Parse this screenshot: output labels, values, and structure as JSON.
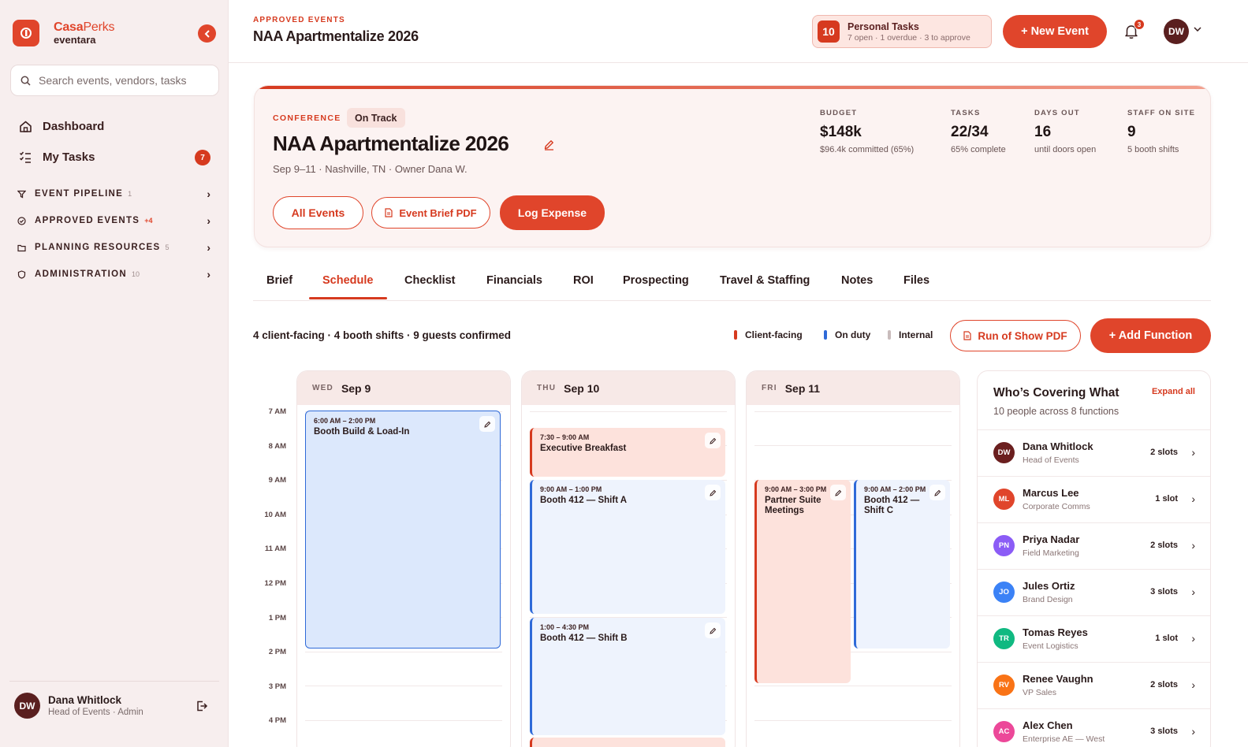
{
  "brand": {
    "name_primary": "Casa",
    "name_secondary": "Perks",
    "product": "eventara",
    "accent": "#e0452b"
  },
  "search": {
    "placeholder": "Search events, vendors, tasks"
  },
  "nav": {
    "dashboard": "Dashboard",
    "my_tasks": "My Tasks",
    "my_tasks_count": "7"
  },
  "sections": [
    {
      "label": "EVENT PIPELINE",
      "count": "1"
    },
    {
      "label": "APPROVED EVENTS",
      "count": "+4"
    },
    {
      "label": "PLANNING RESOURCES",
      "count": "5"
    },
    {
      "label": "ADMINISTRATION",
      "count": "10"
    }
  ],
  "user": {
    "initials": "DW",
    "name": "Dana Whitlock",
    "role": "Head of Events · Admin"
  },
  "topbar": {
    "crumb": "APPROVED EVENTS",
    "title": "NAA Apartmentalize 2026",
    "personal_tasks_count": "10",
    "personal_tasks_title": "Personal Tasks",
    "personal_tasks_sub": "7 open · 1 overdue · 3 to approve",
    "new_event": "+ New Event",
    "notifications": "3",
    "avatar": "DW"
  },
  "event": {
    "type": "CONFERENCE",
    "status": "On Track",
    "name": "NAA Apartmentalize 2026",
    "meta": "Sep 9–11 · Nashville, TN · Owner Dana W.",
    "btn_all": "All Events",
    "btn_brief": "Event Brief PDF",
    "btn_expense": "Log Expense",
    "stats": [
      {
        "label": "BUDGET",
        "value": "$148k",
        "sub": "$96.4k committed (65%)"
      },
      {
        "label": "TASKS",
        "value": "22/34",
        "sub": "65% complete"
      },
      {
        "label": "DAYS OUT",
        "value": "16",
        "sub": "until doors open"
      },
      {
        "label": "STAFF ON SITE",
        "value": "9",
        "sub": "5 booth shifts"
      }
    ]
  },
  "tabs": [
    "Brief",
    "Schedule",
    "Checklist",
    "Financials",
    "ROI",
    "Prospecting",
    "Travel & Staffing",
    "Notes",
    "Files"
  ],
  "active_tab": "Schedule",
  "schedule": {
    "summary": "4 client-facing · 4 booth shifts · 9 guests confirmed",
    "legend": [
      {
        "label": "Client-facing",
        "color": "#d63a1f"
      },
      {
        "label": "On duty",
        "color": "#2f6ad8"
      },
      {
        "label": "Internal",
        "color": "#c9bcbc"
      }
    ],
    "run_of_show": "Run of Show PDF",
    "add_function": "+ Add Function",
    "times": [
      "7 AM",
      "8 AM",
      "9 AM",
      "10 AM",
      "11 AM",
      "12 PM",
      "1 PM",
      "2 PM",
      "3 PM",
      "4 PM"
    ],
    "days": [
      {
        "dow": "WED",
        "date": "Sep 9"
      },
      {
        "dow": "THU",
        "date": "Sep 10"
      },
      {
        "dow": "FRI",
        "date": "Sep 11"
      }
    ],
    "events": [
      {
        "time": "6:00 AM – 2:00 PM",
        "name": "Booth Build & Load-In"
      },
      {
        "time": "7:30 – 9:00 AM",
        "name": "Executive Breakfast"
      },
      {
        "time": "9:00 AM – 1:00 PM",
        "name": "Booth 412 — Shift A"
      },
      {
        "time": "1:00 – 4:30 PM",
        "name": "Booth 412 — Shift B"
      },
      {
        "time": "9:00 AM – 3:00 PM",
        "name": "Partner Suite Meetings"
      },
      {
        "time": "9:00 AM – 2:00 PM",
        "name": "Booth 412 — Shift C"
      }
    ]
  },
  "coverage": {
    "title": "Who’s Covering What",
    "subtitle": "10 people across 8 functions",
    "expand": "Expand all",
    "people": [
      {
        "initials": "DW",
        "name": "Dana Whitlock",
        "role": "Head of Events",
        "slots": "2 slots",
        "color": "#6b1f1f"
      },
      {
        "initials": "ML",
        "name": "Marcus Lee",
        "role": "Corporate Comms",
        "slots": "1 slot",
        "color": "#e0452b"
      },
      {
        "initials": "PN",
        "name": "Priya Nadar",
        "role": "Field Marketing",
        "slots": "2 slots",
        "color": "#8b5cf6"
      },
      {
        "initials": "JO",
        "name": "Jules Ortiz",
        "role": "Brand Design",
        "slots": "3 slots",
        "color": "#3b82f6"
      },
      {
        "initials": "TR",
        "name": "Tomas Reyes",
        "role": "Event Logistics",
        "slots": "1 slot",
        "color": "#10b981"
      },
      {
        "initials": "RV",
        "name": "Renee Vaughn",
        "role": "VP Sales",
        "slots": "2 slots",
        "color": "#f97316"
      },
      {
        "initials": "AC",
        "name": "Alex Chen",
        "role": "Enterprise AE — West",
        "slots": "3 slots",
        "color": "#ec4899"
      }
    ]
  }
}
